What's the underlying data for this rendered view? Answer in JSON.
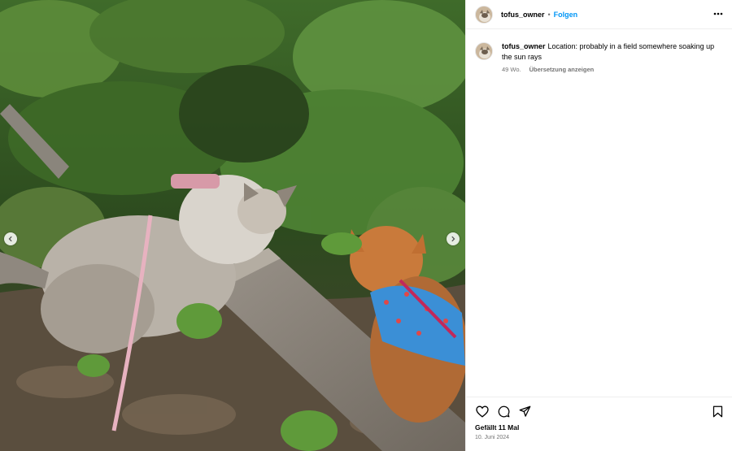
{
  "header": {
    "username": "tofus_owner",
    "separator": "•",
    "follow_label": "Folgen"
  },
  "caption": {
    "username": "tofus_owner",
    "text": "Location: probably in a field somewhere soaking up the sun rays",
    "age": "49 Wo.",
    "translate_label": "Übersetzung anzeigen"
  },
  "footer": {
    "likes": "Gefällt 11 Mal",
    "date": "10. Juni 2024"
  },
  "icons": {
    "header_more": "more-horizontal-icon",
    "like": "heart-icon",
    "comment": "comment-icon",
    "share": "share-icon",
    "save": "bookmark-icon",
    "prev": "chevron-left-icon",
    "next": "chevron-right-icon"
  },
  "colors": {
    "accent": "#0095f6",
    "secondary_text": "#737373",
    "divider": "#efefef"
  },
  "photo": {
    "description_alt": "Two cats on a leash in the woods"
  }
}
